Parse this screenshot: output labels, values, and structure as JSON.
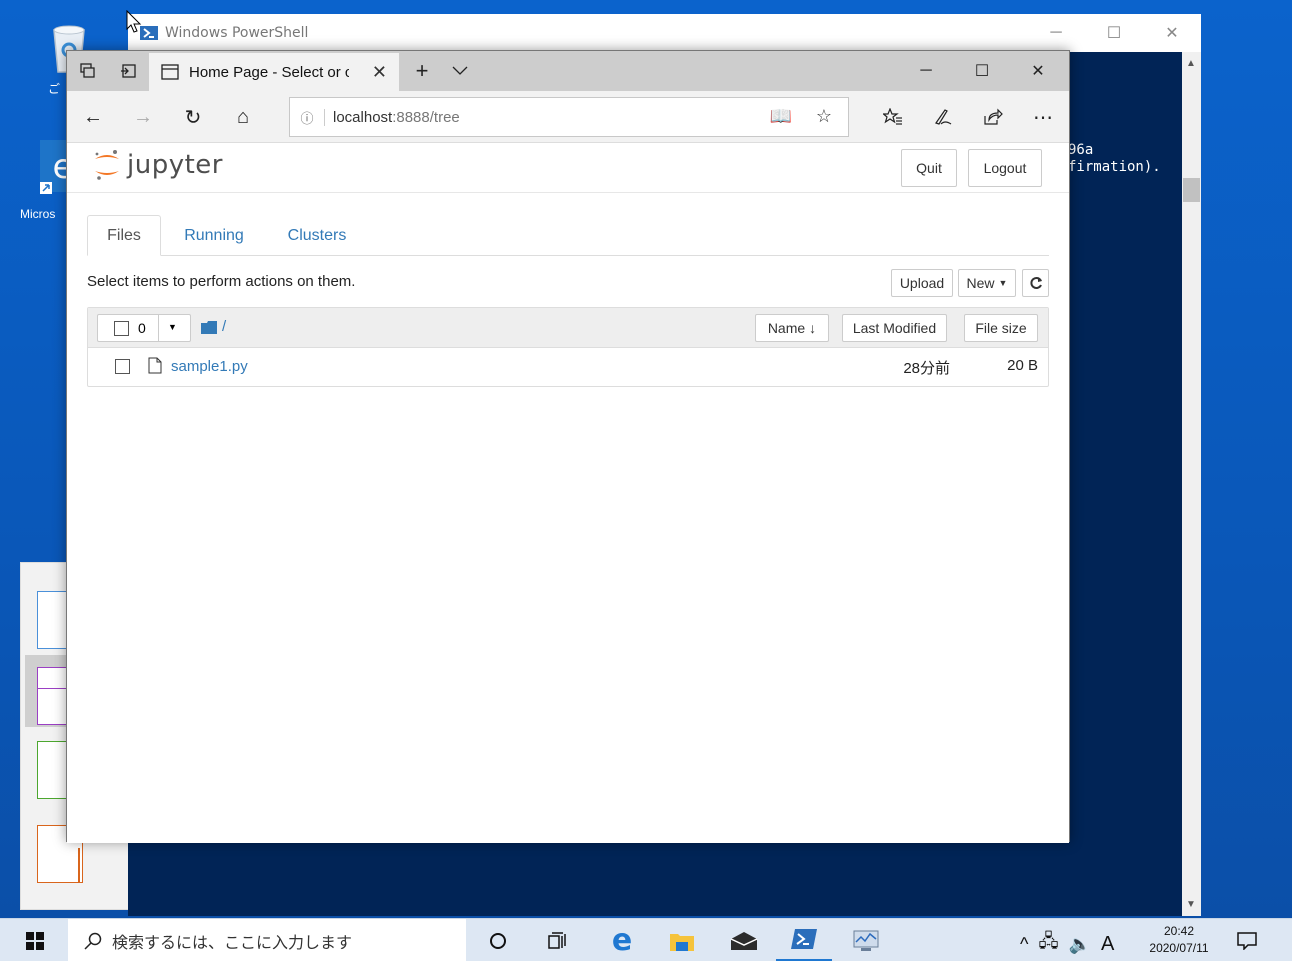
{
  "desktop": {
    "icon_labels": [
      "ご",
      "Micros"
    ]
  },
  "powershell": {
    "title": "Windows PowerShell",
    "console_lines": [
      "96a",
      "firmation)."
    ]
  },
  "browser": {
    "tab_title": "Home Page - Select or c",
    "url_host": "localhost",
    "url_rest": ":8888/tree"
  },
  "jupyter": {
    "logo_text": "jupyter",
    "quit_label": "Quit",
    "logout_label": "Logout",
    "tabs": [
      {
        "label": "Files",
        "active": true
      },
      {
        "label": "Running",
        "active": false
      },
      {
        "label": "Clusters",
        "active": false
      }
    ],
    "hint": "Select items to perform actions on them.",
    "upload_label": "Upload",
    "new_label": "New",
    "selected_count": "0",
    "breadcrumb": "/",
    "columns": {
      "name": "Name",
      "last_modified": "Last Modified",
      "file_size": "File size"
    },
    "files": [
      {
        "name": "sample1.py",
        "modified": "28分前",
        "size": "20 B"
      }
    ],
    "accent_color": "#337ab7",
    "logo_orange": "#f37726"
  },
  "taskbar": {
    "search_placeholder": "検索するには、ここに入力します",
    "time": "20:42",
    "date": "2020/07/11",
    "ime": "A"
  }
}
